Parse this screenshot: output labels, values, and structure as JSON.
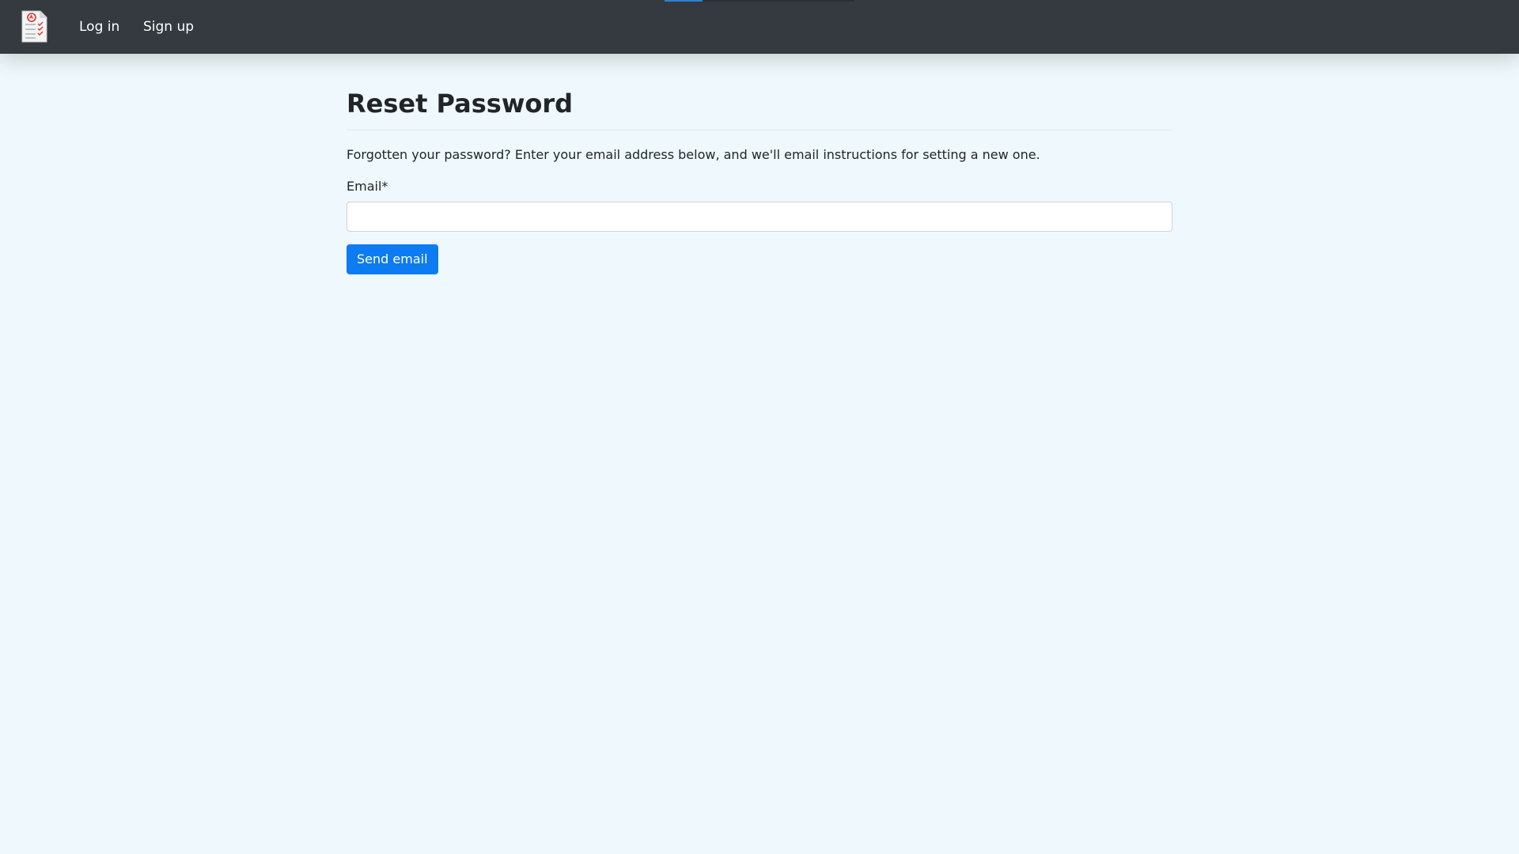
{
  "navbar": {
    "logo_icon": "checklist-document-icon",
    "login_label": "Log in",
    "signup_label": "Sign up",
    "progress_fraction": 0.2,
    "background_color": "#343a40",
    "progress_color": "#2e7fd6"
  },
  "page": {
    "title": "Reset Password",
    "intro": "Forgotten your password? Enter your email address below, and we'll email instructions for setting a new one.",
    "background_color": "#eff8fc"
  },
  "form": {
    "email_label": "Email*",
    "email_value": "",
    "email_placeholder": "",
    "submit_label": "Send email",
    "submit_color": "#0d7bf2"
  }
}
